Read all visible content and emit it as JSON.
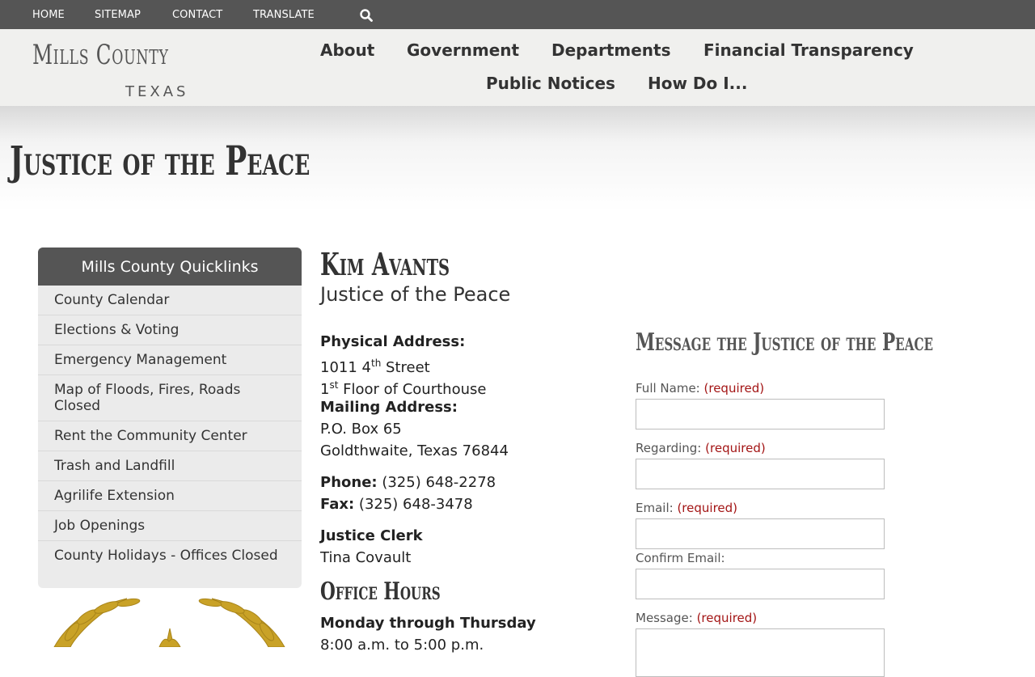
{
  "topbar": {
    "links": [
      "HOME",
      "SITEMAP",
      "CONTACT",
      "TRANSLATE"
    ],
    "search_icon": "search-icon"
  },
  "logo": {
    "main": "Mills County",
    "sub": "TEXAS"
  },
  "nav": {
    "row1": [
      "About",
      "Government",
      "Departments",
      "Financial Transparency"
    ],
    "row2": [
      "Public Notices",
      "How Do I..."
    ]
  },
  "page_title": "Justice of the Peace",
  "quicklinks": {
    "title": "Mills County Quicklinks",
    "items": [
      "County Calendar",
      "Elections & Voting",
      "Emergency Management",
      "Map of Floods, Fires, Roads Closed",
      "Rent the Community Center",
      "Trash and Landfill",
      "Agrilife Extension",
      "Job Openings",
      "County Holidays - Offices Closed"
    ]
  },
  "official": {
    "name": "Kim Avants",
    "role": "Justice of the Peace",
    "physical_label": "Physical Address:",
    "physical_line1_pre": "1011 4",
    "physical_line1_sup": "th",
    "physical_line1_post": " Street",
    "physical_line2_pre": "1",
    "physical_line2_sup": "st",
    "physical_line2_post": " Floor of Courthouse",
    "mailing_label": "Mailing Address:",
    "mailing_line1": "P.O. Box 65",
    "mailing_line2": "Goldthwaite, Texas 76844",
    "phone_label": "Phone:",
    "phone": " (325) 648-2278",
    "fax_label": "Fax:",
    "fax": " (325) 648-3478",
    "clerk_label": "Justice Clerk",
    "clerk_name": "Tina Covault",
    "hours_title": "Office Hours",
    "hours_days": "Monday through Thursday",
    "hours_time": "8:00 a.m. to 5:00 p.m."
  },
  "form": {
    "title": "Message the Justice of the Peace",
    "required": "(required)",
    "fields": {
      "full_name": "Full Name:",
      "regarding": "Regarding:",
      "email": "Email:",
      "confirm_email": "Confirm Email:",
      "message": "Message:"
    }
  }
}
